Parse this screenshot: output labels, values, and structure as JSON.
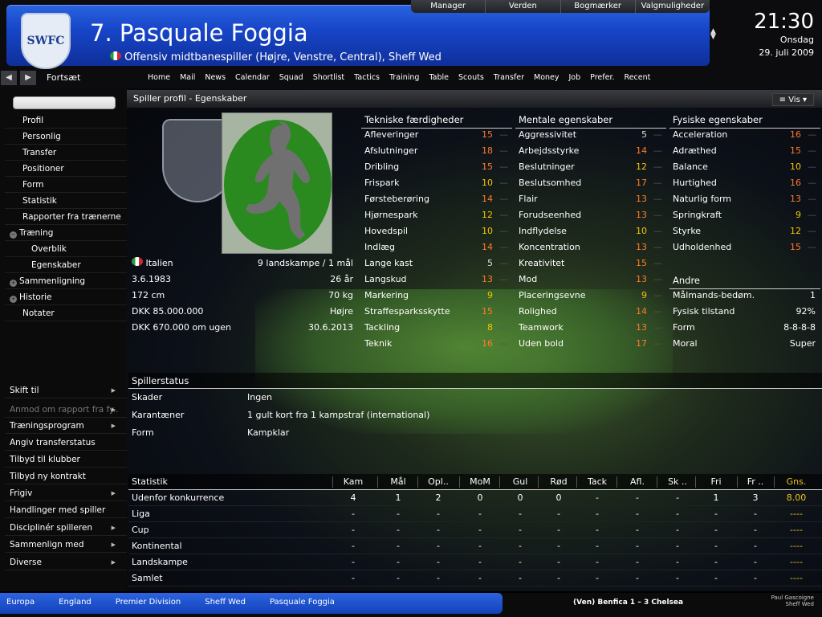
{
  "header": {
    "crest_text": "SWFC",
    "player_title": "7. Pasquale Foggia",
    "player_subtitle": "Offensiv midtbanespiller (Højre, Venstre, Central), Sheff Wed",
    "top_menu": [
      "Manager",
      "Verden",
      "Bogmærker",
      "Valgmuligheder"
    ],
    "clock": {
      "time": "21:30",
      "day": "Onsdag",
      "date": "29. juli 2009"
    }
  },
  "nav": {
    "continue_label": "Fortsæt",
    "items": [
      "Home",
      "Mail",
      "News",
      "Calendar",
      "Squad",
      "Shortlist",
      "Tactics",
      "Training",
      "Table",
      "Scouts",
      "Transfer",
      "Money",
      "Job",
      "Prefer.",
      "Recent"
    ]
  },
  "sidebar": {
    "items": [
      "Profil",
      "Personlig",
      "Transfer",
      "Positioner",
      "Form",
      "Statistik",
      "Rapporter fra trænerne",
      "Træning",
      "Overblik",
      "Egenskaber",
      "Sammenligning",
      "Historie",
      "Notater"
    ],
    "actions": [
      "Skift til",
      "Anmod om rapport fra fy..",
      "Træningsprogram",
      "Angiv transferstatus",
      "Tilbyd til klubber",
      "Tilbyd ny kontrakt",
      "Frigiv",
      "Handlinger med spiller",
      "Disciplinér spilleren",
      "Sammenlign med",
      "Diverse"
    ]
  },
  "panel": {
    "title": "Spiller profil - Egenskaber",
    "vis_label": "Vis",
    "info": [
      {
        "left": "Italien",
        "right": "9 landskampe / 1 mål"
      },
      {
        "left": "3.6.1983",
        "right": "26 år"
      },
      {
        "left": "172 cm",
        "right": "70 kg"
      },
      {
        "left": "DKK 85.000.000",
        "right": "Højre"
      },
      {
        "left": "DKK 670.000 om ugen",
        "right": "30.6.2013"
      }
    ],
    "technical": {
      "header": "Tekniske færdigheder",
      "rows": [
        {
          "name": "Afleveringer",
          "value": "15"
        },
        {
          "name": "Afslutninger",
          "value": "18"
        },
        {
          "name": "Dribling",
          "value": "15"
        },
        {
          "name": "Frispark",
          "value": "10"
        },
        {
          "name": "Førsteberøring",
          "value": "14"
        },
        {
          "name": "Hjørnespark",
          "value": "12"
        },
        {
          "name": "Hovedspil",
          "value": "10"
        },
        {
          "name": "Indlæg",
          "value": "14"
        },
        {
          "name": "Lange kast",
          "value": "5"
        },
        {
          "name": "Langskud",
          "value": "13"
        },
        {
          "name": "Markering",
          "value": "9"
        },
        {
          "name": "Straffesparksskytte",
          "value": "15"
        },
        {
          "name": "Tackling",
          "value": "8"
        },
        {
          "name": "Teknik",
          "value": "16"
        }
      ]
    },
    "mental": {
      "header": "Mentale egenskaber",
      "rows": [
        {
          "name": "Aggressivitet",
          "value": "5"
        },
        {
          "name": "Arbejdsstyrke",
          "value": "14"
        },
        {
          "name": "Beslutninger",
          "value": "12"
        },
        {
          "name": "Beslutsomhed",
          "value": "17"
        },
        {
          "name": "Flair",
          "value": "13"
        },
        {
          "name": "Forudseenhed",
          "value": "13"
        },
        {
          "name": "Indflydelse",
          "value": "10"
        },
        {
          "name": "Koncentration",
          "value": "13"
        },
        {
          "name": "Kreativitet",
          "value": "15"
        },
        {
          "name": "Mod",
          "value": "13"
        },
        {
          "name": "Placeringsevne",
          "value": "9"
        },
        {
          "name": "Rolighed",
          "value": "14"
        },
        {
          "name": "Teamwork",
          "value": "13"
        },
        {
          "name": "Uden bold",
          "value": "17"
        }
      ]
    },
    "physical": {
      "header": "Fysiske egenskaber",
      "rows": [
        {
          "name": "Acceleration",
          "value": "16"
        },
        {
          "name": "Adræthed",
          "value": "15"
        },
        {
          "name": "Balance",
          "value": "10"
        },
        {
          "name": "Hurtighed",
          "value": "16"
        },
        {
          "name": "Naturlig form",
          "value": "13"
        },
        {
          "name": "Springkraft",
          "value": "9"
        },
        {
          "name": "Styrke",
          "value": "12"
        },
        {
          "name": "Udholdenhed",
          "value": "15"
        }
      ]
    },
    "other": {
      "header": "Andre",
      "rows": [
        {
          "name": "Målmands-bedøm.",
          "value": "1"
        },
        {
          "name": "Fysisk tilstand",
          "value": "92%"
        },
        {
          "name": "Form",
          "value": "8-8-8-8"
        },
        {
          "name": "Moral",
          "value": "Super"
        }
      ]
    },
    "status": {
      "header": "Spillerstatus",
      "rows": [
        {
          "label": "Skader",
          "value": "Ingen"
        },
        {
          "label": "Karantæner",
          "value": "1 gult kort fra 1 kampstraf (international)"
        },
        {
          "label": "Form",
          "value": "Kampklar"
        }
      ]
    },
    "stats": {
      "columns": [
        "Statistik",
        "Kam",
        "Mål",
        "Opl..",
        "MoM",
        "Gul",
        "Rød",
        "Tack",
        "Afl.",
        "Sk ..",
        "Fri",
        "Fr ..",
        "Gns."
      ],
      "rows": [
        [
          "Udenfor konkurrence",
          "4",
          "1",
          "2",
          "0",
          "0",
          "0",
          "-",
          "-",
          "-",
          "1",
          "3",
          "8.00"
        ],
        [
          "Liga",
          "-",
          "-",
          "-",
          "-",
          "-",
          "-",
          "-",
          "-",
          "-",
          "-",
          "-",
          "----"
        ],
        [
          "Cup",
          "-",
          "-",
          "-",
          "-",
          "-",
          "-",
          "-",
          "-",
          "-",
          "-",
          "-",
          "----"
        ],
        [
          "Kontinental",
          "-",
          "-",
          "-",
          "-",
          "-",
          "-",
          "-",
          "-",
          "-",
          "-",
          "-",
          "----"
        ],
        [
          "Landskampe",
          "-",
          "-",
          "-",
          "-",
          "-",
          "-",
          "-",
          "-",
          "-",
          "-",
          "-",
          "----"
        ],
        [
          "Samlet",
          "-",
          "-",
          "-",
          "-",
          "-",
          "-",
          "-",
          "-",
          "-",
          "-",
          "-",
          "----"
        ]
      ]
    }
  },
  "footer": {
    "breadcrumbs": [
      "Europa",
      "England",
      "Premier Division",
      "Sheff Wed",
      "Pasquale Foggia"
    ],
    "score": "(Ven) Benfica 1 – 3 Chelsea",
    "manager_line1": "Paul Gascoigne",
    "manager_line2": "Sheff Wed"
  },
  "colors": {
    "accent": "#1a4fd6",
    "high": "#ff7a2a",
    "mid": "#e6b800",
    "avg_value": "#f0c020"
  }
}
